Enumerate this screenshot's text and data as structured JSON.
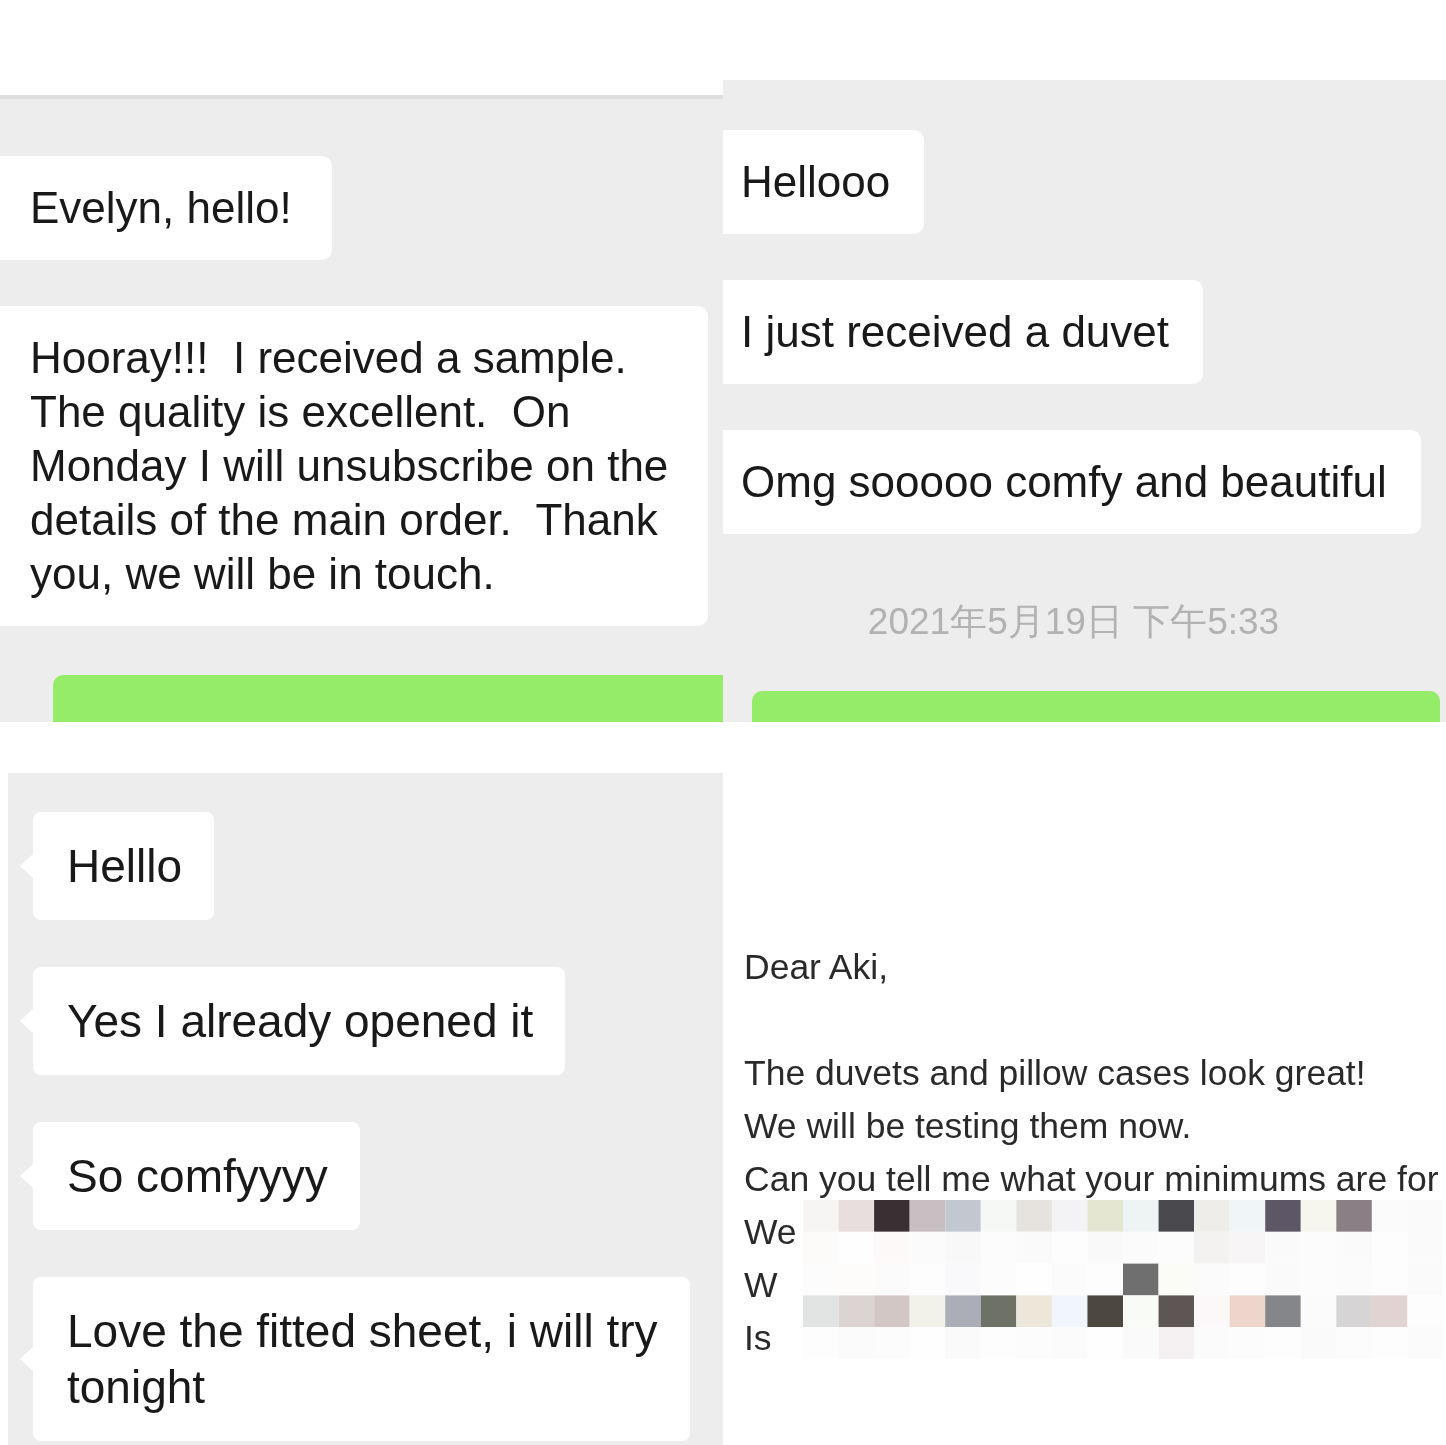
{
  "panels": [
    {
      "kind": "chat",
      "messages": [
        {
          "kind": "incoming",
          "text": "Evelyn, hello!"
        },
        {
          "kind": "incoming",
          "text": "Hooray!!!  I received a sample.\nThe quality is excellent.  On\nMonday I will unsubscribe on the\ndetails of the main order.  Thank\nyou, we will be in touch."
        },
        {
          "kind": "outgoing"
        }
      ]
    },
    {
      "kind": "chat",
      "messages": [
        {
          "kind": "incoming",
          "text": "Hellooo"
        },
        {
          "kind": "incoming",
          "text": "I just received a duvet"
        },
        {
          "kind": "incoming",
          "text": "Omg sooooo comfy and beautiful"
        },
        {
          "kind": "timestamp",
          "text": "2021年5月19日 下午5:33"
        },
        {
          "kind": "outgoing"
        }
      ]
    },
    {
      "kind": "chat",
      "messages": [
        {
          "kind": "incoming",
          "text": "Helllo"
        },
        {
          "kind": "incoming",
          "text": "Yes I already opened it"
        },
        {
          "kind": "incoming",
          "text": "So comfyyyy"
        },
        {
          "kind": "incoming",
          "text": "Love the fitted sheet, i will try\ntonight"
        }
      ]
    },
    {
      "kind": "email",
      "greeting": "Dear Aki,",
      "lines": [
        "The duvets and pillow cases look great!",
        "We will be testing them now.",
        "Can you tell me what your minimums are for"
      ],
      "redacted_lines": [
        "We",
        "W",
        "Is"
      ]
    }
  ]
}
